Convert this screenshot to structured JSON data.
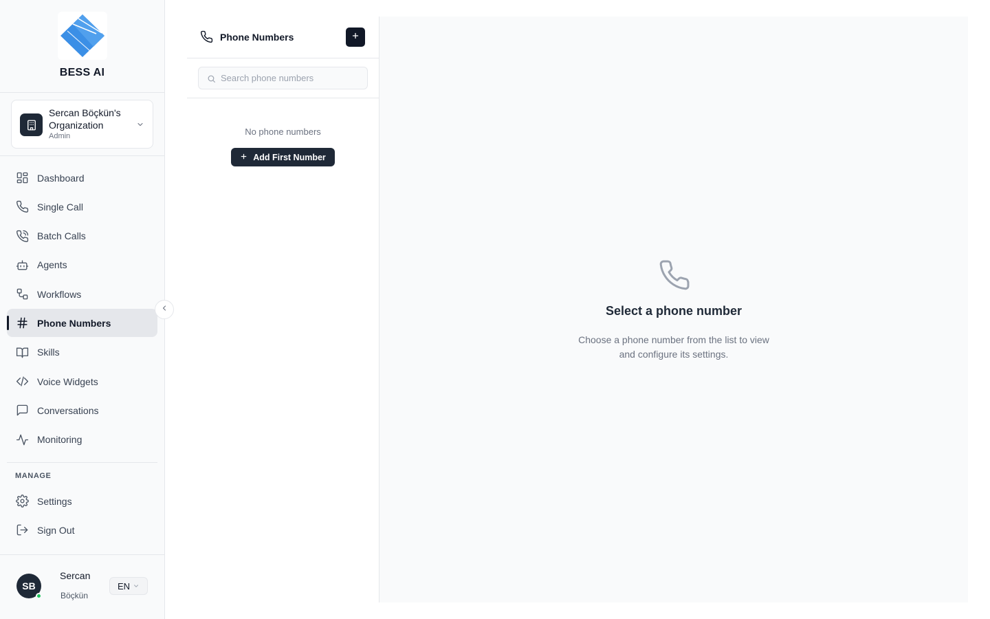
{
  "brand": {
    "name": "BESS AI",
    "logo_color": "#3b8fe6"
  },
  "organization": {
    "name": "Sercan Böçkün's Organization",
    "role": "Admin"
  },
  "nav": {
    "items": [
      {
        "label": "Dashboard",
        "icon": "dashboard-icon"
      },
      {
        "label": "Single Call",
        "icon": "phone-icon"
      },
      {
        "label": "Batch Calls",
        "icon": "phone-calls-icon"
      },
      {
        "label": "Agents",
        "icon": "bot-icon"
      },
      {
        "label": "Workflows",
        "icon": "workflow-icon"
      },
      {
        "label": "Phone Numbers",
        "icon": "hash-icon",
        "active": true
      },
      {
        "label": "Skills",
        "icon": "book-icon"
      },
      {
        "label": "Voice Widgets",
        "icon": "code-icon"
      },
      {
        "label": "Conversations",
        "icon": "message-icon"
      },
      {
        "label": "Monitoring",
        "icon": "activity-icon"
      }
    ],
    "manage_label": "MANAGE",
    "manage_items": [
      {
        "label": "Settings",
        "icon": "gear-icon"
      },
      {
        "label": "Sign Out",
        "icon": "sign-out-icon"
      }
    ]
  },
  "user": {
    "initials": "SB",
    "first_name": "Sercan",
    "last_name": "Böçkün",
    "language": "EN",
    "status_color": "#22c55e"
  },
  "list_panel": {
    "title": "Phone Numbers",
    "search_placeholder": "Search phone numbers",
    "search_value": "",
    "empty_text": "No phone numbers",
    "add_first_label": "Add First Number"
  },
  "detail_panel": {
    "title": "Select a phone number",
    "description": "Choose a phone number from the list to view and configure its settings."
  },
  "colors": {
    "primary_dark": "#1f2937",
    "active_nav_bg": "#e5e7eb",
    "sidebar_bg": "#f9fafb"
  }
}
